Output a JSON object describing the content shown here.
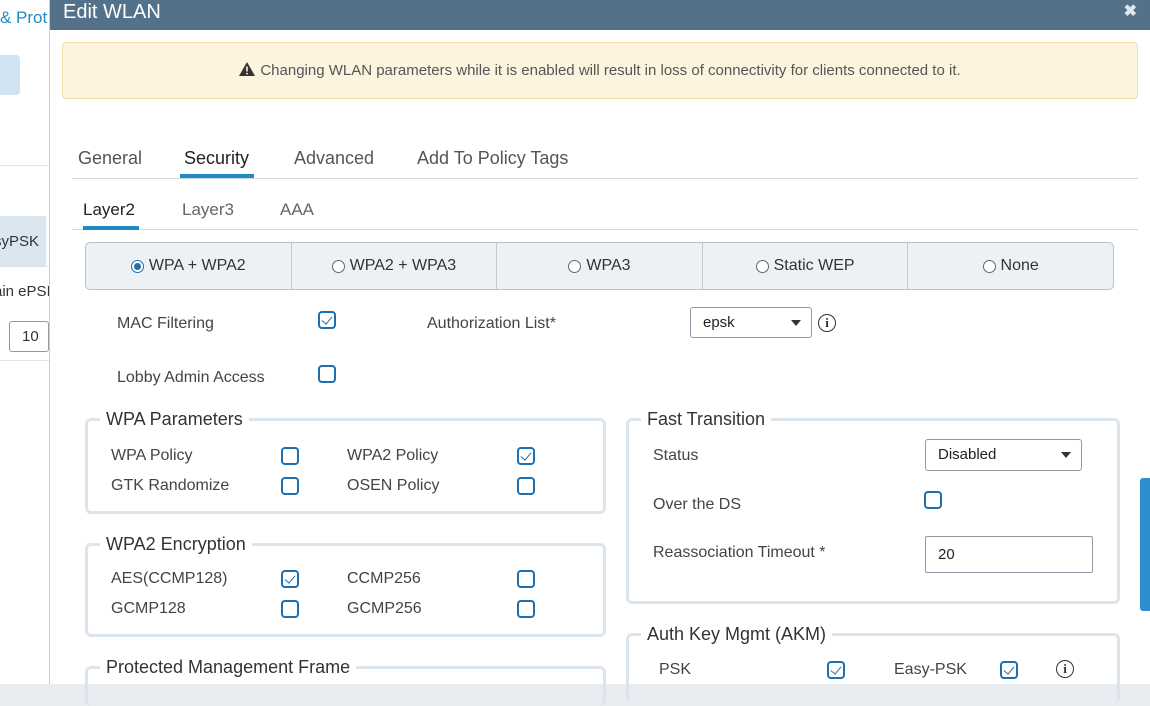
{
  "background": {
    "title": "& Prot",
    "item1": "syPSK",
    "item2": "ain ePSI",
    "input_value": "10"
  },
  "modal": {
    "title": "Edit WLAN",
    "close": "✖"
  },
  "alert": {
    "text": "Changing WLAN parameters while it is enabled will result in loss of connectivity for clients connected to it."
  },
  "tabs": [
    "General",
    "Security",
    "Advanced",
    "Add To Policy Tags"
  ],
  "subtabs": [
    "Layer2",
    "Layer3",
    "AAA"
  ],
  "security_modes": [
    "WPA + WPA2",
    "WPA2 + WPA3",
    "WPA3",
    "Static WEP",
    "None"
  ],
  "security_mode_selected": "WPA + WPA2",
  "mac_filtering": {
    "label": "MAC Filtering",
    "checked": true
  },
  "authorization_list": {
    "label": "Authorization List*",
    "value": "epsk"
  },
  "lobby_admin": {
    "label": "Lobby Admin Access",
    "checked": false
  },
  "wpa_parameters": {
    "title": "WPA Parameters",
    "wpa_policy": "WPA Policy",
    "wpa2_policy": "WPA2 Policy",
    "gtk_randomize": "GTK Randomize",
    "osen_policy": "OSEN Policy"
  },
  "wpa2_encryption": {
    "title": "WPA2 Encryption",
    "aes": "AES(CCMP128)",
    "ccmp256": "CCMP256",
    "gcmp128": "GCMP128",
    "gcmp256": "GCMP256"
  },
  "pmf": {
    "title": "Protected Management Frame"
  },
  "fast_transition": {
    "title": "Fast Transition",
    "status_label": "Status",
    "status_value": "Disabled",
    "over_ds": "Over the DS",
    "reassoc_label": "Reassociation Timeout *",
    "reassoc_value": "20"
  },
  "akm": {
    "title": "Auth Key Mgmt (AKM)",
    "psk": "PSK",
    "easy_psk": "Easy-PSK"
  },
  "colors": {
    "header": "#53718a",
    "accent": "#1e8bc3",
    "checkbox": "#1f6fae"
  }
}
